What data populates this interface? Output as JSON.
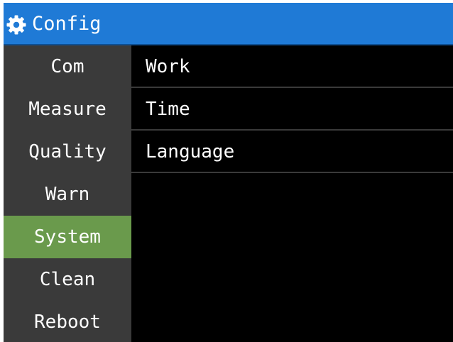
{
  "header": {
    "title": "Config",
    "icon": "gear-icon",
    "color": "#1f7ad6"
  },
  "sidebar": {
    "active_color": "#6a9a4c",
    "items": [
      {
        "label": "Com"
      },
      {
        "label": "Measure"
      },
      {
        "label": "Quality"
      },
      {
        "label": "Warn"
      },
      {
        "label": "System",
        "selected": true
      },
      {
        "label": "Clean"
      },
      {
        "label": "Reboot"
      }
    ]
  },
  "main": {
    "rows": [
      {
        "label": "Work"
      },
      {
        "label": "Time"
      },
      {
        "label": "Language"
      }
    ]
  }
}
